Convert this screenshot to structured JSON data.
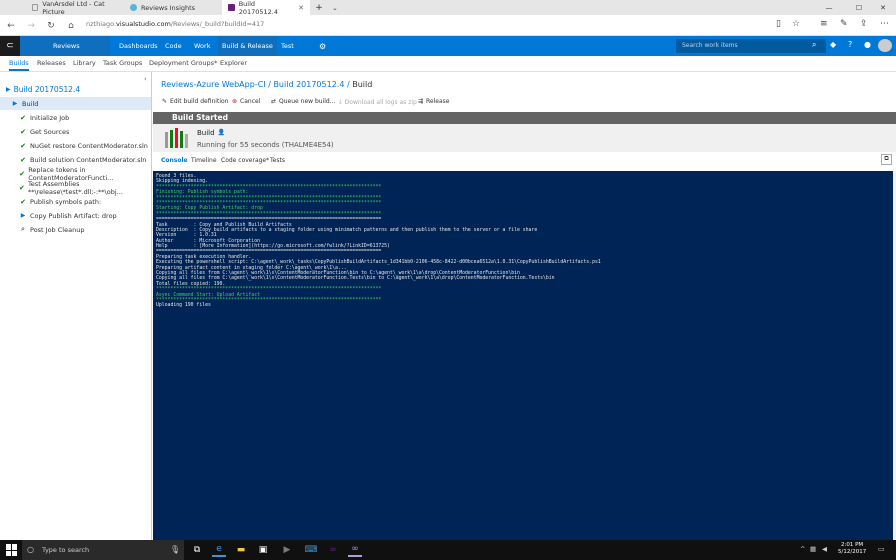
{
  "browser": {
    "tabs": [
      {
        "label": "VanArsdel Ltd - Cat Picture"
      },
      {
        "label": "Reviews Insights"
      },
      {
        "label": "Build 20170512.4"
      }
    ],
    "url_prefix": "nzthiago.",
    "url_domain": "visualstudio.com",
    "url_path": "/Reviews/_build?buildId=417"
  },
  "header": {
    "project": "Reviews",
    "nav": [
      "Dashboards",
      "Code",
      "Work",
      "Build & Release",
      "Test"
    ],
    "selected_nav": "Build & Release",
    "search_placeholder": "Search work items"
  },
  "subnav": {
    "items": [
      "Builds",
      "Releases",
      "Library",
      "Task Groups",
      "Deployment Groups*",
      "Explorer"
    ],
    "selected": "Builds"
  },
  "left": {
    "title": "Build 20170512.4",
    "items": [
      {
        "label": "Build",
        "status": "running"
      },
      {
        "label": "Initialize Job",
        "status": "done"
      },
      {
        "label": "Get Sources",
        "status": "done"
      },
      {
        "label": "NuGet restore ContentModerator.sln",
        "status": "done"
      },
      {
        "label": "Build solution ContentModerator.sln",
        "status": "done"
      },
      {
        "label": "Replace tokens in ContentModeratorFuncti...",
        "status": "done"
      },
      {
        "label": "Test Assemblies **\\release\\*test*.dll;-:**\\obj...",
        "status": "done"
      },
      {
        "label": "Publish symbols path:",
        "status": "done"
      },
      {
        "label": "Copy Publish Artifact: drop",
        "status": "running"
      },
      {
        "label": "Post Job Cleanup",
        "status": "pending"
      }
    ]
  },
  "breadcrumb": {
    "parts": [
      "Reviews-Azure WebApp-CI",
      "Build 20170512.4"
    ],
    "current": "Build"
  },
  "toolbar": {
    "edit": "Edit build definition",
    "cancel": "Cancel",
    "queue": "Queue new build...",
    "download": "Download all logs as zip",
    "release": "Release"
  },
  "status": {
    "banner": "Build Started",
    "name": "Build",
    "detail": "Running for 55 seconds (THALME4E54)"
  },
  "content_tabs": [
    "Console",
    "Timeline",
    "Code coverage*",
    "Tests"
  ],
  "console": {
    "lines": [
      {
        "t": "Found 3 files.",
        "c": "w"
      },
      {
        "t": "Skipping indexing.",
        "c": "w"
      },
      {
        "t": "******************************************************************************",
        "c": "g"
      },
      {
        "t": "Finishing: Publish symbols path:",
        "c": "g"
      },
      {
        "t": "******************************************************************************",
        "c": "g"
      },
      {
        "t": "******************************************************************************",
        "c": "g"
      },
      {
        "t": "Starting: Copy Publish Artifact: drop",
        "c": "g"
      },
      {
        "t": "******************************************************************************",
        "c": "g"
      },
      {
        "t": "==============================================================================",
        "c": "w"
      },
      {
        "t": "Task         : Copy and Publish Build Artifacts",
        "c": "w"
      },
      {
        "t": "Description  : Copy build artifacts to a staging folder using minimatch patterns and then publish them to the server or a file share",
        "c": "w"
      },
      {
        "t": "Version      : 1.0.31",
        "c": "w"
      },
      {
        "t": "Author       : Microsoft Corporation",
        "c": "w"
      },
      {
        "t": "Help         : [More Information](https://go.microsoft.com/fwlink/?LinkID=613725)",
        "c": "w"
      },
      {
        "t": "==============================================================================",
        "c": "w"
      },
      {
        "t": "Preparing task execution handler.",
        "c": "w"
      },
      {
        "t": "Executing the powershell script: C:\\agent\\_work\\_tasks\\CopyPublishBuildArtifacts_1d341bb0-2106-458c-8422-d00bcea6512a\\1.0.31\\CopyPublishBuildArtifacts.ps1",
        "c": "w"
      },
      {
        "t": "Preparing artifact content in staging folder C:\\agent\\_work\\1\\a...",
        "c": "w"
      },
      {
        "t": "Copying all files from C:\\agent\\_work\\1\\s\\ContentModeratorFunction\\bin to C:\\agent\\_work\\1\\a\\drop\\ContentModeratorFunction\\bin",
        "c": "w"
      },
      {
        "t": "Copying all files from C:\\agent\\_work\\1\\s\\ContentModeratorFunction.Tests\\bin to C:\\agent\\_work\\1\\a\\drop\\ContentModeratorFunction.Tests\\bin",
        "c": "w"
      },
      {
        "t": "Total files copied: 190.",
        "c": "w"
      },
      {
        "t": "******************************************************************************",
        "c": "g"
      },
      {
        "t": "Async Command Start: Upload Artifact",
        "c": "g"
      },
      {
        "t": "******************************************************************************",
        "c": "g"
      },
      {
        "t": "Uploading 190 files",
        "c": "w"
      }
    ]
  },
  "taskbar": {
    "search_placeholder": "Type to search",
    "time": "2:01 PM",
    "date": "5/12/2017"
  },
  "colors": {
    "accent": "#0078d7",
    "console_bg": "#012456",
    "console_green": "#3ed05a",
    "success": "#107c10"
  }
}
